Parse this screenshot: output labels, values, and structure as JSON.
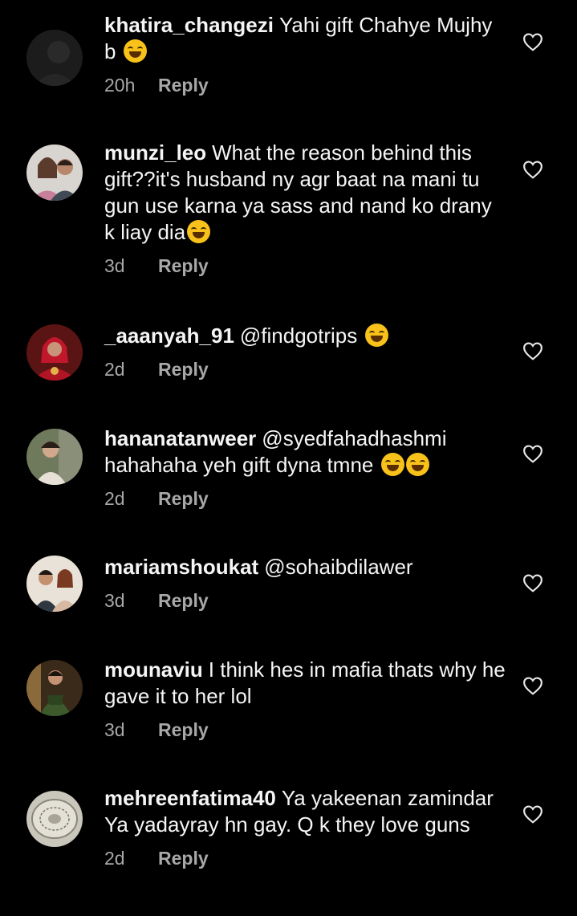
{
  "comments": [
    {
      "username": "khatira_changezi",
      "text": "Yahi gift Chahye Mujhy b",
      "emoji": "😆",
      "time": "20h",
      "reply": "Reply"
    },
    {
      "username": "munzi_leo",
      "text": "What the reason behind this gift??it's husband ny agr baat na mani tu gun use karna ya sass and nand ko drany k liay dia",
      "emoji": "😂",
      "time": "3d",
      "reply": "Reply"
    },
    {
      "username": "_aaanyah_91",
      "text": "@findgotrips",
      "emoji": "😂",
      "time": "2d",
      "reply": "Reply"
    },
    {
      "username": "hananatanweer",
      "text": "@syedfahadhashmi hahahaha yeh gift dyna tmne",
      "emoji": "🤣🤣",
      "time": "2d",
      "reply": "Reply"
    },
    {
      "username": "mariamshoukat",
      "text": "@sohaibdilawer",
      "emoji": "",
      "time": "3d",
      "reply": "Reply"
    },
    {
      "username": "mounaviu",
      "text": "I think hes in mafia thats why he gave it to her lol",
      "emoji": "",
      "time": "3d",
      "reply": "Reply"
    },
    {
      "username": "mehreenfatima40",
      "text": "Ya yakeenan zamindar Ya yadayray hn gay. Q k they love guns",
      "emoji": "",
      "time": "2d",
      "reply": "Reply"
    }
  ],
  "icons": {
    "like": "heart-outline-icon"
  },
  "colors": {
    "background": "#000000",
    "text": "#f5f5f5",
    "meta": "#a8a8a8"
  }
}
